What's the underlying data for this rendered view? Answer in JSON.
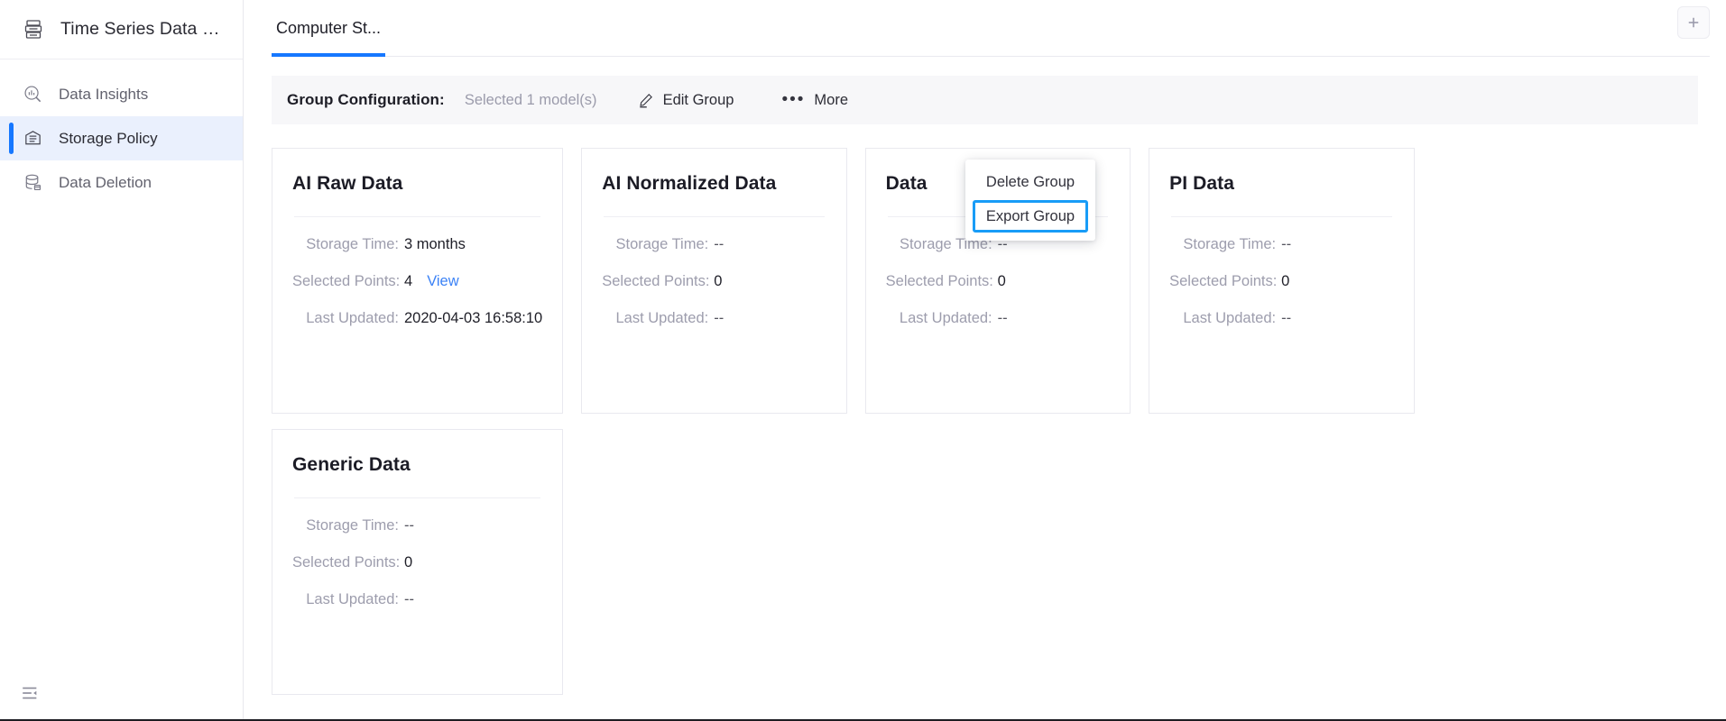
{
  "sidebar": {
    "brand": {
      "title": "Time Series Data …",
      "icon": "database-stack-icon"
    },
    "items": [
      {
        "label": "Data Insights",
        "icon": "insights-chart-icon",
        "active": false
      },
      {
        "label": "Storage Policy",
        "icon": "storage-box-icon",
        "active": true
      },
      {
        "label": "Data Deletion",
        "icon": "database-delete-icon",
        "active": false
      }
    ],
    "collapse_icon": "collapse-sidebar-icon"
  },
  "tabbar": {
    "tabs": [
      {
        "label": "Computer St...",
        "active": true
      }
    ],
    "add_icon": "plus-icon"
  },
  "groupbar": {
    "label": "Group Configuration:",
    "selected_text": "Selected 1 model(s)",
    "edit_label": "Edit  Group",
    "edit_icon": "pencil-icon",
    "more_label": "More",
    "more_icon": "ellipsis-icon"
  },
  "dropdown": {
    "open": true,
    "items": [
      {
        "label": "Delete Group",
        "highlighted": false
      },
      {
        "label": "Export Group",
        "highlighted": true
      }
    ],
    "highlight_color": "#189cf7"
  },
  "card_labels": {
    "storage_time": "Storage Time:",
    "selected_points": "Selected Points:",
    "last_updated": "Last Updated:",
    "view_link": "View"
  },
  "cards": [
    {
      "title": "AI Raw Data",
      "storage_time": "3 months",
      "selected_points": "4",
      "has_view_link": true,
      "last_updated": "2020-04-03 16:58:10"
    },
    {
      "title": "AI Normalized Data",
      "storage_time": "--",
      "selected_points": "0",
      "has_view_link": false,
      "last_updated": "--"
    },
    {
      "title": "Data",
      "storage_time": "--",
      "selected_points": "0",
      "has_view_link": false,
      "last_updated": "--"
    },
    {
      "title": "PI Data",
      "storage_time": "--",
      "selected_points": "0",
      "has_view_link": false,
      "last_updated": "--"
    },
    {
      "title": "Generic Data",
      "storage_time": "--",
      "selected_points": "0",
      "has_view_link": false,
      "last_updated": "--"
    }
  ],
  "colors": {
    "accent": "#1677ff",
    "link": "#3b82f6",
    "active_nav_bg": "#eaf0fd",
    "toolbar_bg": "#f7f7f9"
  }
}
